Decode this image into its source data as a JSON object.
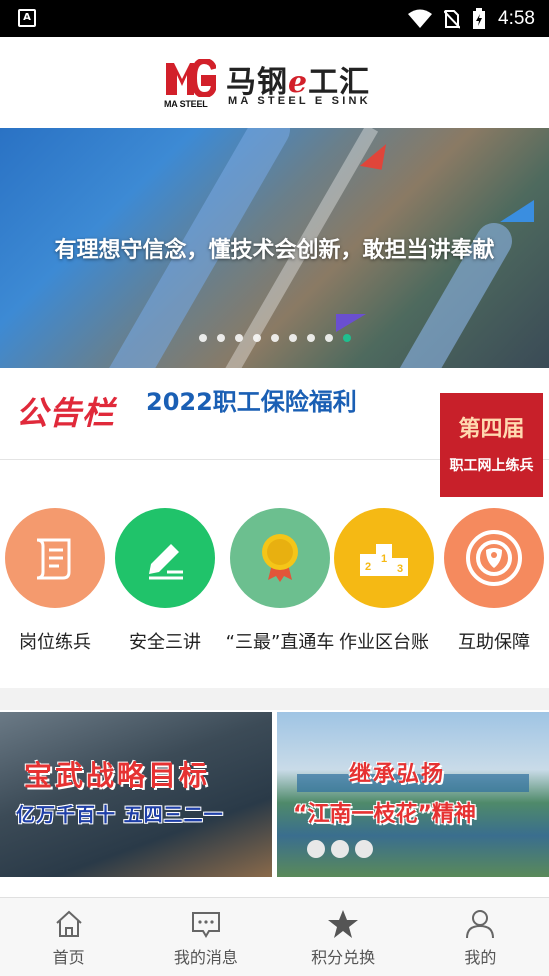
{
  "status_bar": {
    "time": "4:58",
    "left_icon": "A"
  },
  "header": {
    "logo_mark_text": "MA STEEL",
    "logo_cn_prefix": "马钢",
    "logo_cn_e": "e",
    "logo_cn_suffix": "工汇",
    "logo_en": "MA STEEL E SINK"
  },
  "banner": {
    "caption": "有理想守信念，懂技术会创新，敢担当讲奉献",
    "slide_count": 9,
    "active_slide": 9
  },
  "notice": {
    "label": "公告栏",
    "text": "2022职工保险福利",
    "badge_line1": "第四届",
    "badge_line2": "职工网上练兵"
  },
  "grid": {
    "items": [
      {
        "label": "岗位练兵",
        "icon": "scroll-icon",
        "color": "#f49a6e"
      },
      {
        "label": "安全三讲",
        "icon": "pen-icon",
        "color": "#20c36a"
      },
      {
        "label": "“三最”直通车",
        "icon": "medal-icon",
        "color": "#6cbf8f"
      },
      {
        "label": "作业区台账",
        "icon": "podium-icon",
        "color": "#f5b914"
      },
      {
        "label": "互助保障",
        "icon": "shield-icon",
        "color": "#f58a5e"
      }
    ]
  },
  "features": {
    "left": {
      "line1": "宝武战略目标",
      "line2": "亿万千百十 五四三二一"
    },
    "right": {
      "line1": "继承弘扬",
      "line2": "“江南一枝花”精神"
    }
  },
  "tabbar": {
    "tabs": [
      {
        "label": "首页",
        "icon": "home-icon"
      },
      {
        "label": "我的消息",
        "icon": "message-icon"
      },
      {
        "label": "积分兑换",
        "icon": "star-icon"
      },
      {
        "label": "我的",
        "icon": "user-icon"
      }
    ]
  }
}
